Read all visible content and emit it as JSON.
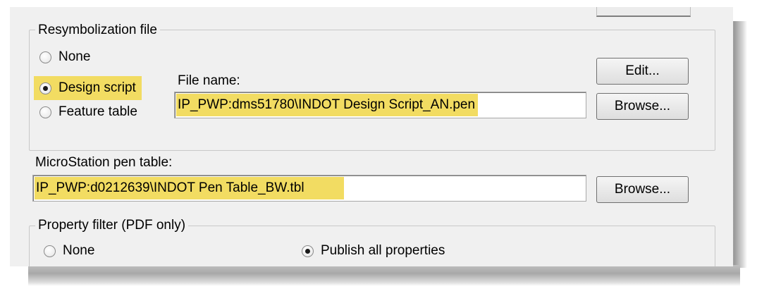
{
  "resymbolization": {
    "legend": "Resymbolization file",
    "options": [
      {
        "label": "None",
        "checked": false
      },
      {
        "label": "Design script",
        "checked": true
      },
      {
        "label": "Feature table",
        "checked": false
      }
    ],
    "file_name_label": "File name:",
    "file_name_value": "IP_PWP:dms51780\\INDOT Design Script_AN.pen",
    "edit_button": "Edit...",
    "browse_button": "Browse..."
  },
  "pen_table": {
    "label": "MicroStation pen table:",
    "value": "IP_PWP:d0212639\\INDOT Pen Table_BW.tbl",
    "browse_button": "Browse..."
  },
  "property_filter": {
    "legend": "Property filter (PDF only)",
    "options": [
      {
        "label": "None",
        "checked": false
      },
      {
        "label": "Publish all properties",
        "checked": true
      }
    ]
  },
  "colors": {
    "highlight": "#f2dc62",
    "dialog_bg": "#f0f0f0"
  }
}
